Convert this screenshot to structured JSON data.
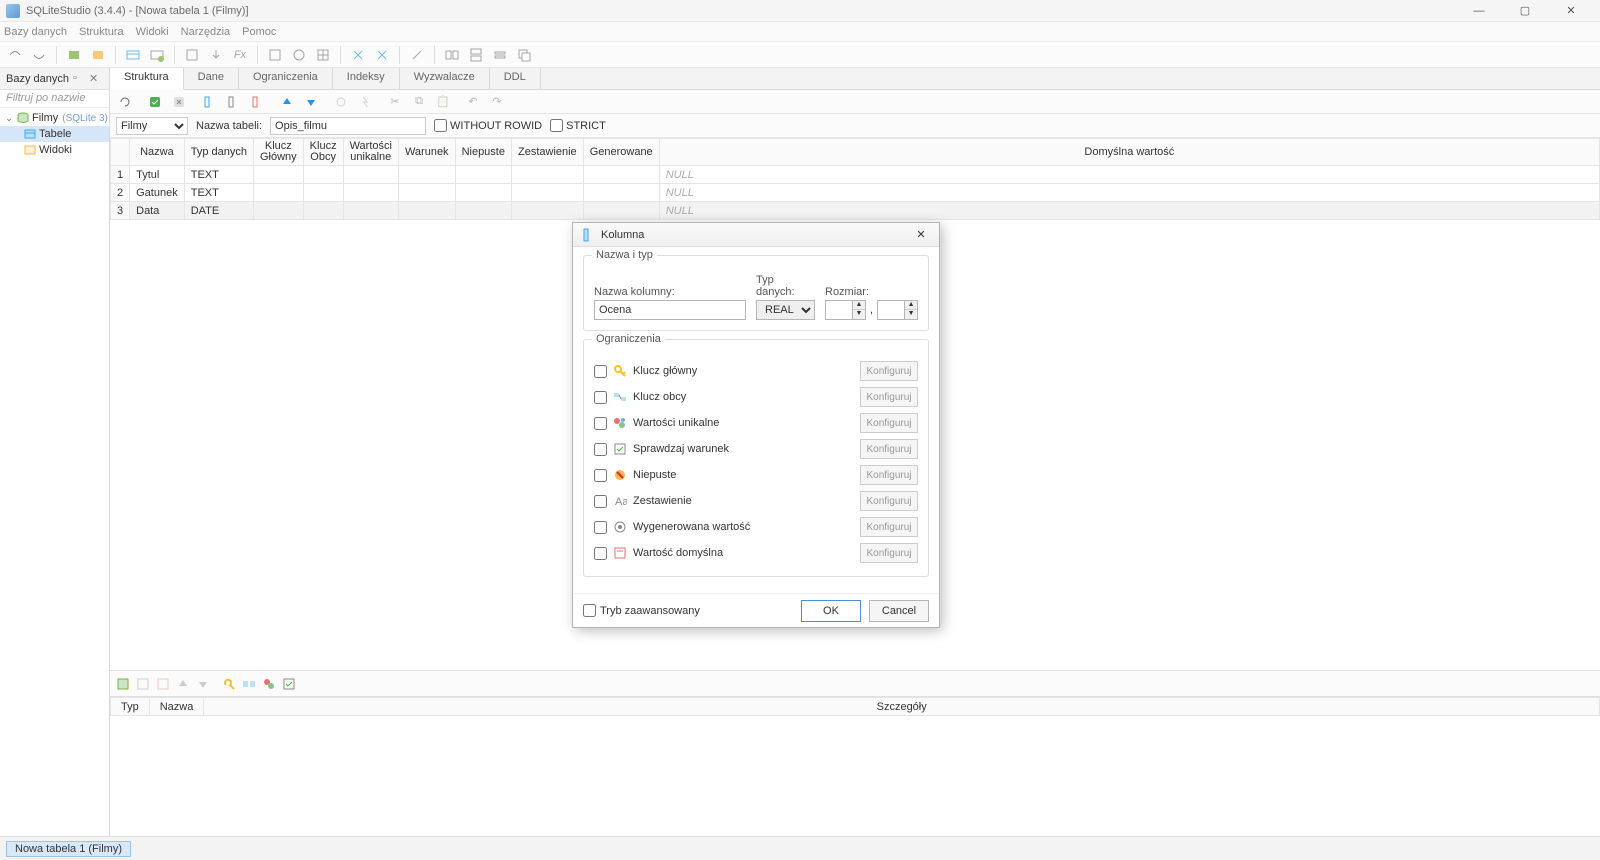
{
  "window": {
    "title": "SQLiteStudio (3.4.4) - [Nowa tabela 1 (Filmy)]"
  },
  "menu": [
    "Bazy danych",
    "Struktura",
    "Widoki",
    "Narzędzia",
    "Pomoc"
  ],
  "sidebar": {
    "title": "Bazy danych",
    "filter_placeholder": "Filtruj po nazwie",
    "root": {
      "name": "Filmy",
      "engine": "(SQLite 3)"
    },
    "children": [
      "Tabele",
      "Widoki"
    ]
  },
  "tabs": [
    "Struktura",
    "Dane",
    "Ograniczenia",
    "Indeksy",
    "Wyzwalacze",
    "DDL"
  ],
  "tableform": {
    "db_label": "Filmy",
    "name_label": "Nazwa tabeli:",
    "name_value": "Opis_filmu",
    "without_rowid": "WITHOUT ROWID",
    "strict": "STRICT"
  },
  "columns": {
    "headers": [
      "",
      "Nazwa",
      "Typ danych",
      "Klucz Główny",
      "Klucz Obcy",
      "Wartości unikalne",
      "Warunek",
      "Niepuste",
      "Zestawienie",
      "Generowane",
      "Domyślna wartość"
    ],
    "rows": [
      {
        "n": "1",
        "name": "Tytul",
        "type": "TEXT",
        "def": "NULL"
      },
      {
        "n": "2",
        "name": "Gatunek",
        "type": "TEXT",
        "def": "NULL"
      },
      {
        "n": "3",
        "name": "Data",
        "type": "DATE",
        "def": "NULL"
      }
    ]
  },
  "details": {
    "headers": [
      "Typ",
      "Nazwa",
      "Szczegóły"
    ]
  },
  "status": {
    "doc": "Nowa tabela 1 (Filmy)"
  },
  "dialog": {
    "title": "Kolumna",
    "group1": "Nazwa i typ",
    "col_label": "Nazwa kolumny:",
    "col_value": "Ocena",
    "type_label": "Typ danych:",
    "type_value": "REAL",
    "size_label": "Rozmiar:",
    "comma": ",",
    "group2": "Ograniczenia",
    "constraints": [
      "Klucz główny",
      "Klucz obcy",
      "Wartości unikalne",
      "Sprawdzaj warunek",
      "Niepuste",
      "Zestawienie",
      "Wygenerowana wartość",
      "Wartość domyślna"
    ],
    "configure": "Konfiguruj",
    "advanced": "Tryb zaawansowany",
    "ok": "OK",
    "cancel": "Cancel"
  }
}
